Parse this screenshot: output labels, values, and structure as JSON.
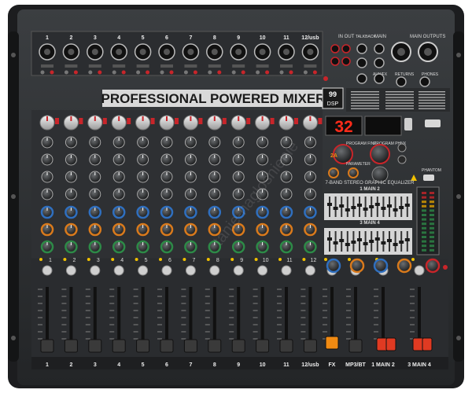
{
  "product": {
    "title": "PROFESSIONAL POWERED MIXER",
    "dsp_badge_top": "99",
    "dsp_badge_bottom": "DSP",
    "led_display": "32",
    "main_outputs_label": "MAIN OUTPUTS",
    "eq_title": "7-BAND STEREO GRAPHIC EQUALIZER",
    "eq_main2": "1 MAIN 2",
    "eq_main4": "3 MAIN 4",
    "program_label_1": "PROGRAM FINE",
    "program_label_2": "PROGRAM PHNX",
    "parameter_label": "PARAMETER",
    "phantom_label": "PHANTOM",
    "watermark": "tanie-nagłośnienie"
  },
  "top_jacks": {
    "in_out": "IN  OUT",
    "talkback": "TALKBACK",
    "main": "MAIN",
    "aux": "AUX/FX",
    "returns": "RETURNS",
    "phones": "PHONES"
  },
  "channels": [
    "1",
    "2",
    "3",
    "4",
    "5",
    "6",
    "7",
    "8",
    "9",
    "10",
    "11",
    "12/usb"
  ],
  "bottom_labels": [
    "1",
    "2",
    "3",
    "4",
    "5",
    "6",
    "7",
    "8",
    "9",
    "10",
    "11",
    "12/usb",
    "FX",
    "MP3/BT",
    "1 MAIN 2",
    "3 MAIN 4"
  ],
  "colors": {
    "body": "#2f3133",
    "panel": "#3d4043",
    "accent_orange": "#f08a12",
    "accent_red": "#e03a22",
    "led_red": "#ff2b1a",
    "knob_blue": "#2f6fbf",
    "knob_orange": "#d97a1c",
    "knob_green": "#2d8a47",
    "knob_red": "#c8252a"
  }
}
